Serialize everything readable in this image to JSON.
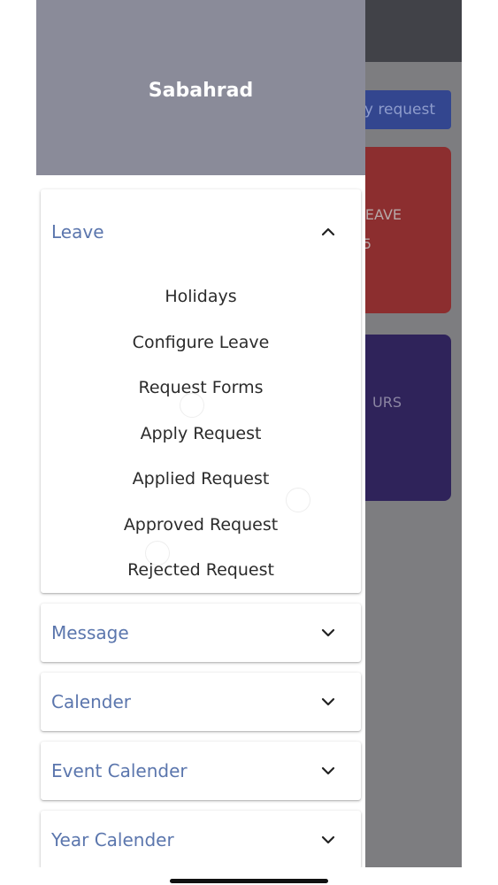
{
  "background_app": {
    "apply_button_label": "y request",
    "leave_card_title": "EAVE",
    "leave_card_value": "5",
    "hours_card_title": "URS",
    "colors": {
      "topbar": "#414248",
      "button": "#33468f",
      "leave_card": "#8c2e2f",
      "hours_card": "#2f235a"
    }
  },
  "drawer": {
    "header": {
      "username": "Sabahrad",
      "bg_color": "#8a8b99"
    },
    "sections": [
      {
        "label": "Leave",
        "expanded": true,
        "icon": "chevron-up-icon",
        "items": [
          "Holidays",
          "Configure Leave",
          "Request Forms",
          "Apply Request",
          "Applied Request",
          "Approved Request",
          "Rejected Request"
        ]
      },
      {
        "label": "Message",
        "expanded": false,
        "icon": "chevron-down-icon"
      },
      {
        "label": "Calender",
        "expanded": false,
        "icon": "chevron-down-icon"
      },
      {
        "label": "Event Calender",
        "expanded": false,
        "icon": "chevron-down-icon"
      },
      {
        "label": "Year Calender",
        "expanded": false,
        "icon": "chevron-down-icon"
      }
    ],
    "accent_color": "#5b76ad"
  }
}
